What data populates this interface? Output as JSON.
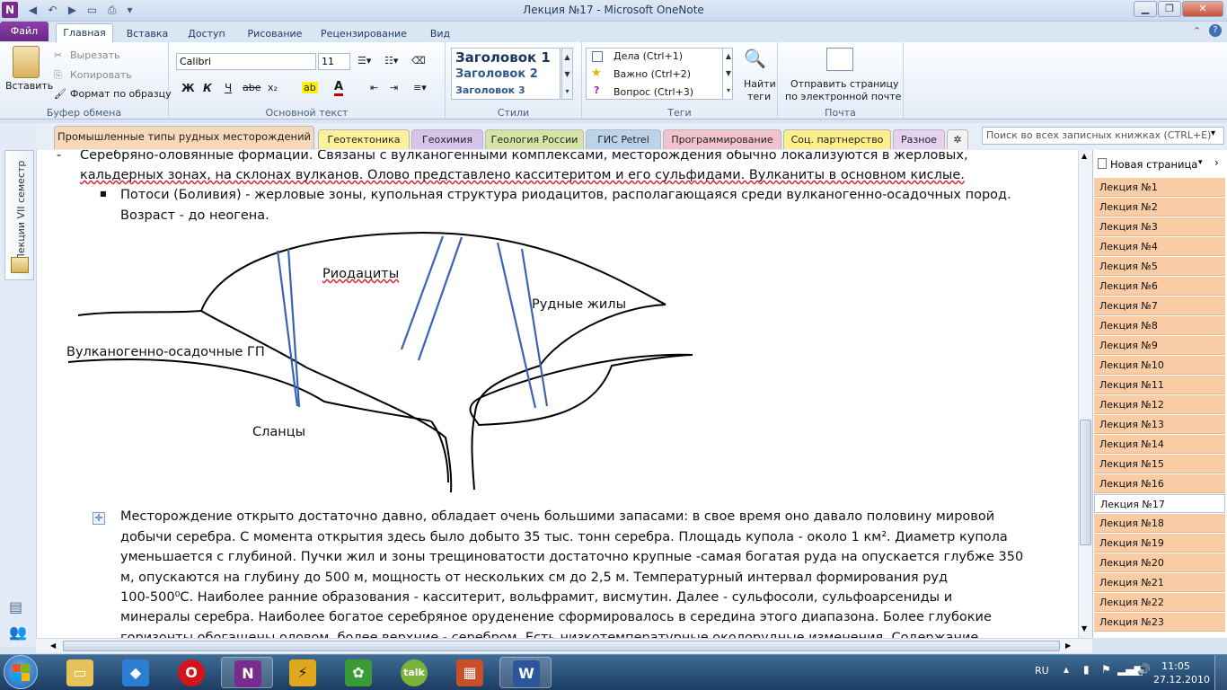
{
  "window": {
    "title": "Лекция №17 - Microsoft OneNote",
    "app_icon": "N"
  },
  "ribbon_tabs": [
    "Файл",
    "Главная",
    "Вставка",
    "Доступ",
    "Рисование",
    "Рецензирование",
    "Вид"
  ],
  "clipboard": {
    "paste": "Вставить",
    "cut": "Вырезать",
    "copy": "Копировать",
    "format_painter": "Формат по образцу",
    "group_label": "Буфер обмена"
  },
  "basic_text": {
    "font": "Calibri",
    "size": "11",
    "bold": "Ж",
    "italic": "К",
    "underline": "Ч",
    "strike": "abe",
    "subscript": "x₂",
    "highlight": "ab",
    "font_color": "A",
    "group_label": "Основной текст"
  },
  "styles": {
    "items": [
      "Заголовок 1",
      "Заголовок 2",
      "Заголовок 3"
    ],
    "group_label": "Стили"
  },
  "tags": {
    "items": [
      "Дела (Ctrl+1)",
      "Важно (Ctrl+2)",
      "Вопрос (Ctrl+3)"
    ],
    "find_tags_1": "Найти",
    "find_tags_2": "теги",
    "group_label": "Теги"
  },
  "mail": {
    "line1": "Отправить страницу",
    "line2": "по электронной почте",
    "group_label": "Почта"
  },
  "section_tabs": [
    {
      "label": "Промышленные типы рудных месторождений",
      "color": "#f7d9b9",
      "active": true
    },
    {
      "label": "Геотектоника",
      "color": "#fdf29a"
    },
    {
      "label": "Геохимия",
      "color": "#d8c4ea"
    },
    {
      "label": "Геология России",
      "color": "#d6e4a8"
    },
    {
      "label": "ГИС Petrel",
      "color": "#bcd3ec"
    },
    {
      "label": "Программирование",
      "color": "#f3c2cf"
    },
    {
      "label": "Соц. партнерство",
      "color": "#fcef8c"
    },
    {
      "label": "Разное",
      "color": "#e6d2f0"
    }
  ],
  "search": {
    "placeholder": "Поиск во всех записных книжках (CTRL+E)"
  },
  "notebook": {
    "label": "Лекции VII семестр"
  },
  "content": {
    "line1": "Серебряно-оловянные формации. Связаны с вулканогенными комплексами, месторождения обычно локализуются в жерловых,",
    "line2": "кальдерных зонах, на склонах вулканов. Олово представлено касситеритом и его сульфидами. Вулканиты в основном кислые.",
    "line3": "Потоси (Боливия) - жерловые зоны, купольная структура риодацитов, располагающаяся среди вулканогенно-осадочных пород.",
    "line4": "Возраст - до неогена.",
    "para": [
      "Месторождение открыто достаточно давно, обладает очень большими запасами: в свое время оно давало половину мировой",
      "добычи серебра. С момента открытия здесь было добыто 35 тыс. тонн серебра. Площадь купола - около 1 км². Диаметр купола",
      "уменьшается с глубиной. Пучки жил и зоны трещиноватости достаточно крупные -самая богатая руда на опускается глубже 350",
      "м, опускаются на глубину до 500 м, мощность от нескольких см до 2,5 м. Температурный интервал формирования руд",
      "100-500⁰С.  Наиболее ранние образования - касситерит, вольфрамит, висмутин. Далее - сульфосоли, сульфоарсениды и",
      "минералы серебра. Наиболее богатое серебряное оруденение сформировалось в середина этого диапазона. Более глубокие",
      "горизонты обогащены оловом, более верхние - серебром. Есть низкотемпературные околорудные изменения. Содержание"
    ]
  },
  "diagram": {
    "label_rhyodacite": "Риодациты",
    "label_veins": "Рудные жилы",
    "label_volcanic": "Вулканогенно-осадочные ГП",
    "label_shale": "Сланцы"
  },
  "pages_panel": {
    "new_page": "Новая страница",
    "pages": [
      "Лекция №1",
      "Лекция №2",
      "Лекция №3",
      "Лекция №4",
      "Лекция №5",
      "Лекция №6",
      "Лекция №7",
      "Лекция №8",
      "Лекция №9",
      "Лекция №10",
      "Лекция №11",
      "Лекция №12",
      "Лекция №13",
      "Лекция №14",
      "Лекция №15",
      "Лекция №16",
      "Лекция №17",
      "Лекция №18",
      "Лекция №19",
      "Лекция №20",
      "Лекция №21",
      "Лекция №22",
      "Лекция №23"
    ],
    "selected": "Лекция №17"
  },
  "taskbar": {
    "lang": "RU",
    "time": "11:05",
    "date": "27.12.2010",
    "apps": [
      "explorer",
      "dropbox",
      "opera",
      "onenote",
      "winamp",
      "plant",
      "talk",
      "presentation",
      "word"
    ]
  }
}
